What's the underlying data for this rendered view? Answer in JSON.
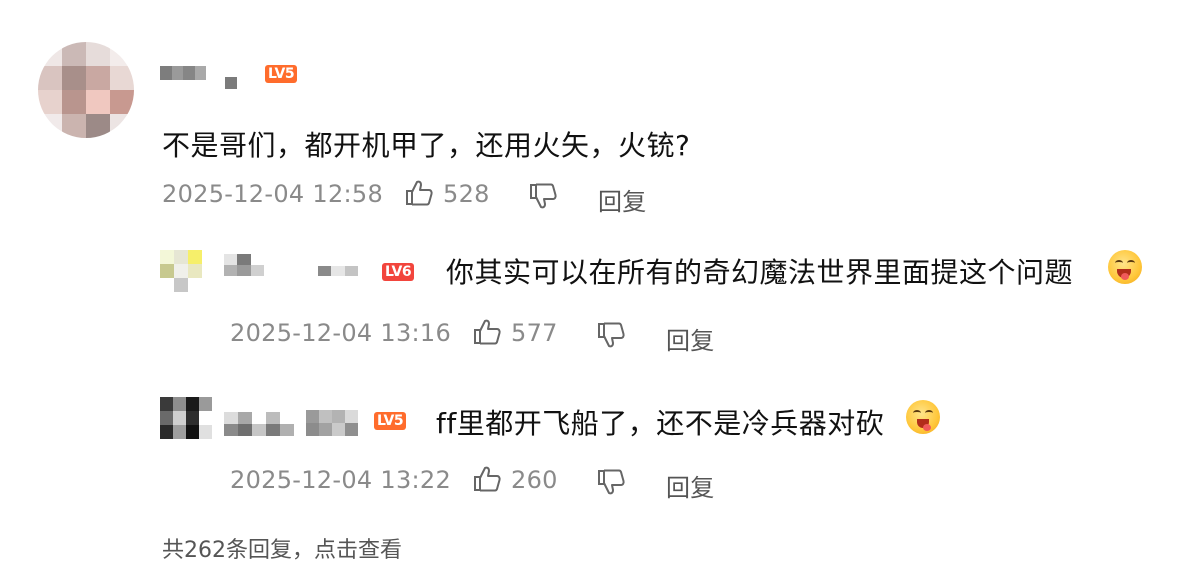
{
  "thread": {
    "main": {
      "level": "LV5",
      "text": "不是哥们，都开机甲了，还用火矢，火铳?",
      "time": "2025-12-04 12:58",
      "likes": "528",
      "reply_label": "回复"
    },
    "replies": [
      {
        "level": "LV6",
        "text": "你其实可以在所有的奇幻魔法世界里面提这个问题",
        "time": "2025-12-04 13:16",
        "likes": "577",
        "reply_label": "回复",
        "emoji": "drooling-face"
      },
      {
        "level": "LV5",
        "text": "ff里都开飞船了，还不是冷兵器对砍",
        "time": "2025-12-04 13:22",
        "likes": "260",
        "reply_label": "回复",
        "emoji": "savoring-face"
      }
    ],
    "footer": {
      "more_replies": "共262条回复，点击查看"
    }
  },
  "colors": {
    "badge_orange": "#ff6c2c",
    "badge_red": "#f2453d",
    "meta_gray": "#8a8a8a",
    "text_dark": "#111111"
  },
  "icons": {
    "like": "thumbs-up-icon",
    "dislike": "thumbs-down-icon"
  }
}
